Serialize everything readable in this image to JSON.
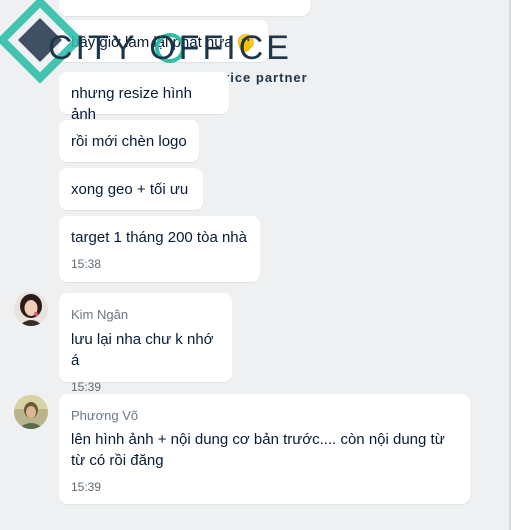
{
  "logo": {
    "brand_name": "CITY OFFICE",
    "tagline": "Office service partner",
    "primary_color": "#1e3448",
    "accent_color": "#2fbfa8"
  },
  "messages": [
    {
      "text": "bây giờ làm lại phát nữa 🙂"
    },
    {
      "text": "nhưng resize hình ảnh"
    },
    {
      "text": "rồi mới chèn logo"
    },
    {
      "text": "xong geo + tối ưu"
    },
    {
      "text": "target 1 tháng 200 tòa nhà",
      "time": "15:38"
    }
  ],
  "kim_ngan": {
    "sender": "Kim Ngân",
    "text": "lưu lại nha chư k nhớ á",
    "time": "15:39"
  },
  "phuong_vo": {
    "sender": "Phương Võ",
    "text": "lên hình ảnh + nội dung cơ bản trước.... còn nội dung từ từ có rồi đăng",
    "time": "15:39"
  }
}
